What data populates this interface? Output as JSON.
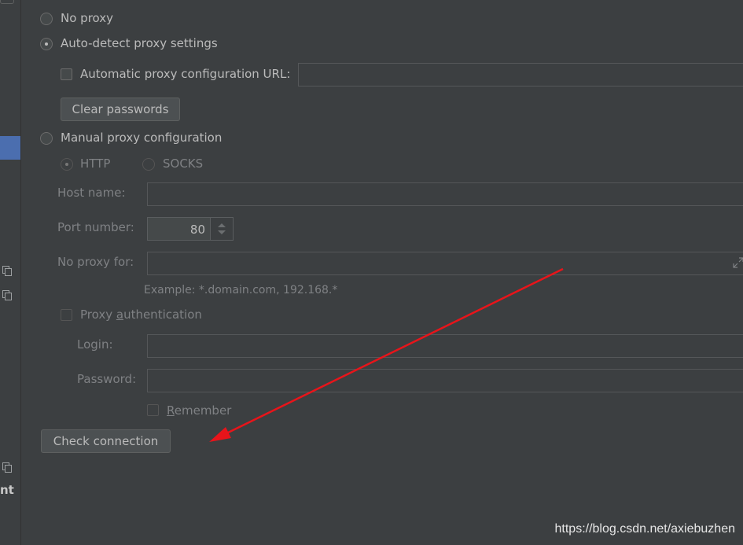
{
  "proxy": {
    "no_proxy": "No proxy",
    "auto_detect": "Auto-detect proxy settings",
    "auto_config_url_label": "Automatic proxy configuration URL:",
    "auto_config_url_value": "",
    "clear_passwords": "Clear passwords",
    "manual": "Manual proxy configuration",
    "http": "HTTP",
    "socks": "SOCKS",
    "host_label": "Host name:",
    "host_value": "",
    "port_label": "Port number:",
    "port_value": "80",
    "no_proxy_for_label": "No proxy for:",
    "no_proxy_for_value": "",
    "example": "Example: *.domain.com, 192.168.*",
    "proxy_auth_prefix": "Proxy ",
    "proxy_auth_mnemonic": "a",
    "proxy_auth_suffix": "uthentication",
    "login_label": "Login:",
    "login_value": "",
    "password_label": "Password:",
    "password_value": "",
    "remember_mnemonic": "R",
    "remember_suffix": "emember",
    "check_connection": "Check connection",
    "selected_option": "Auto-detect proxy settings"
  },
  "sidebar": {
    "partial_text": "nt"
  },
  "watermark": "https://blog.csdn.net/axiebuzhen",
  "colors": {
    "background": "#3c3f41",
    "selection": "#4b6eaf",
    "annotation_arrow": "#e8141a"
  },
  "icons": [
    "copy-icon",
    "expand-icon",
    "spinner-up-icon",
    "spinner-down-icon"
  ]
}
